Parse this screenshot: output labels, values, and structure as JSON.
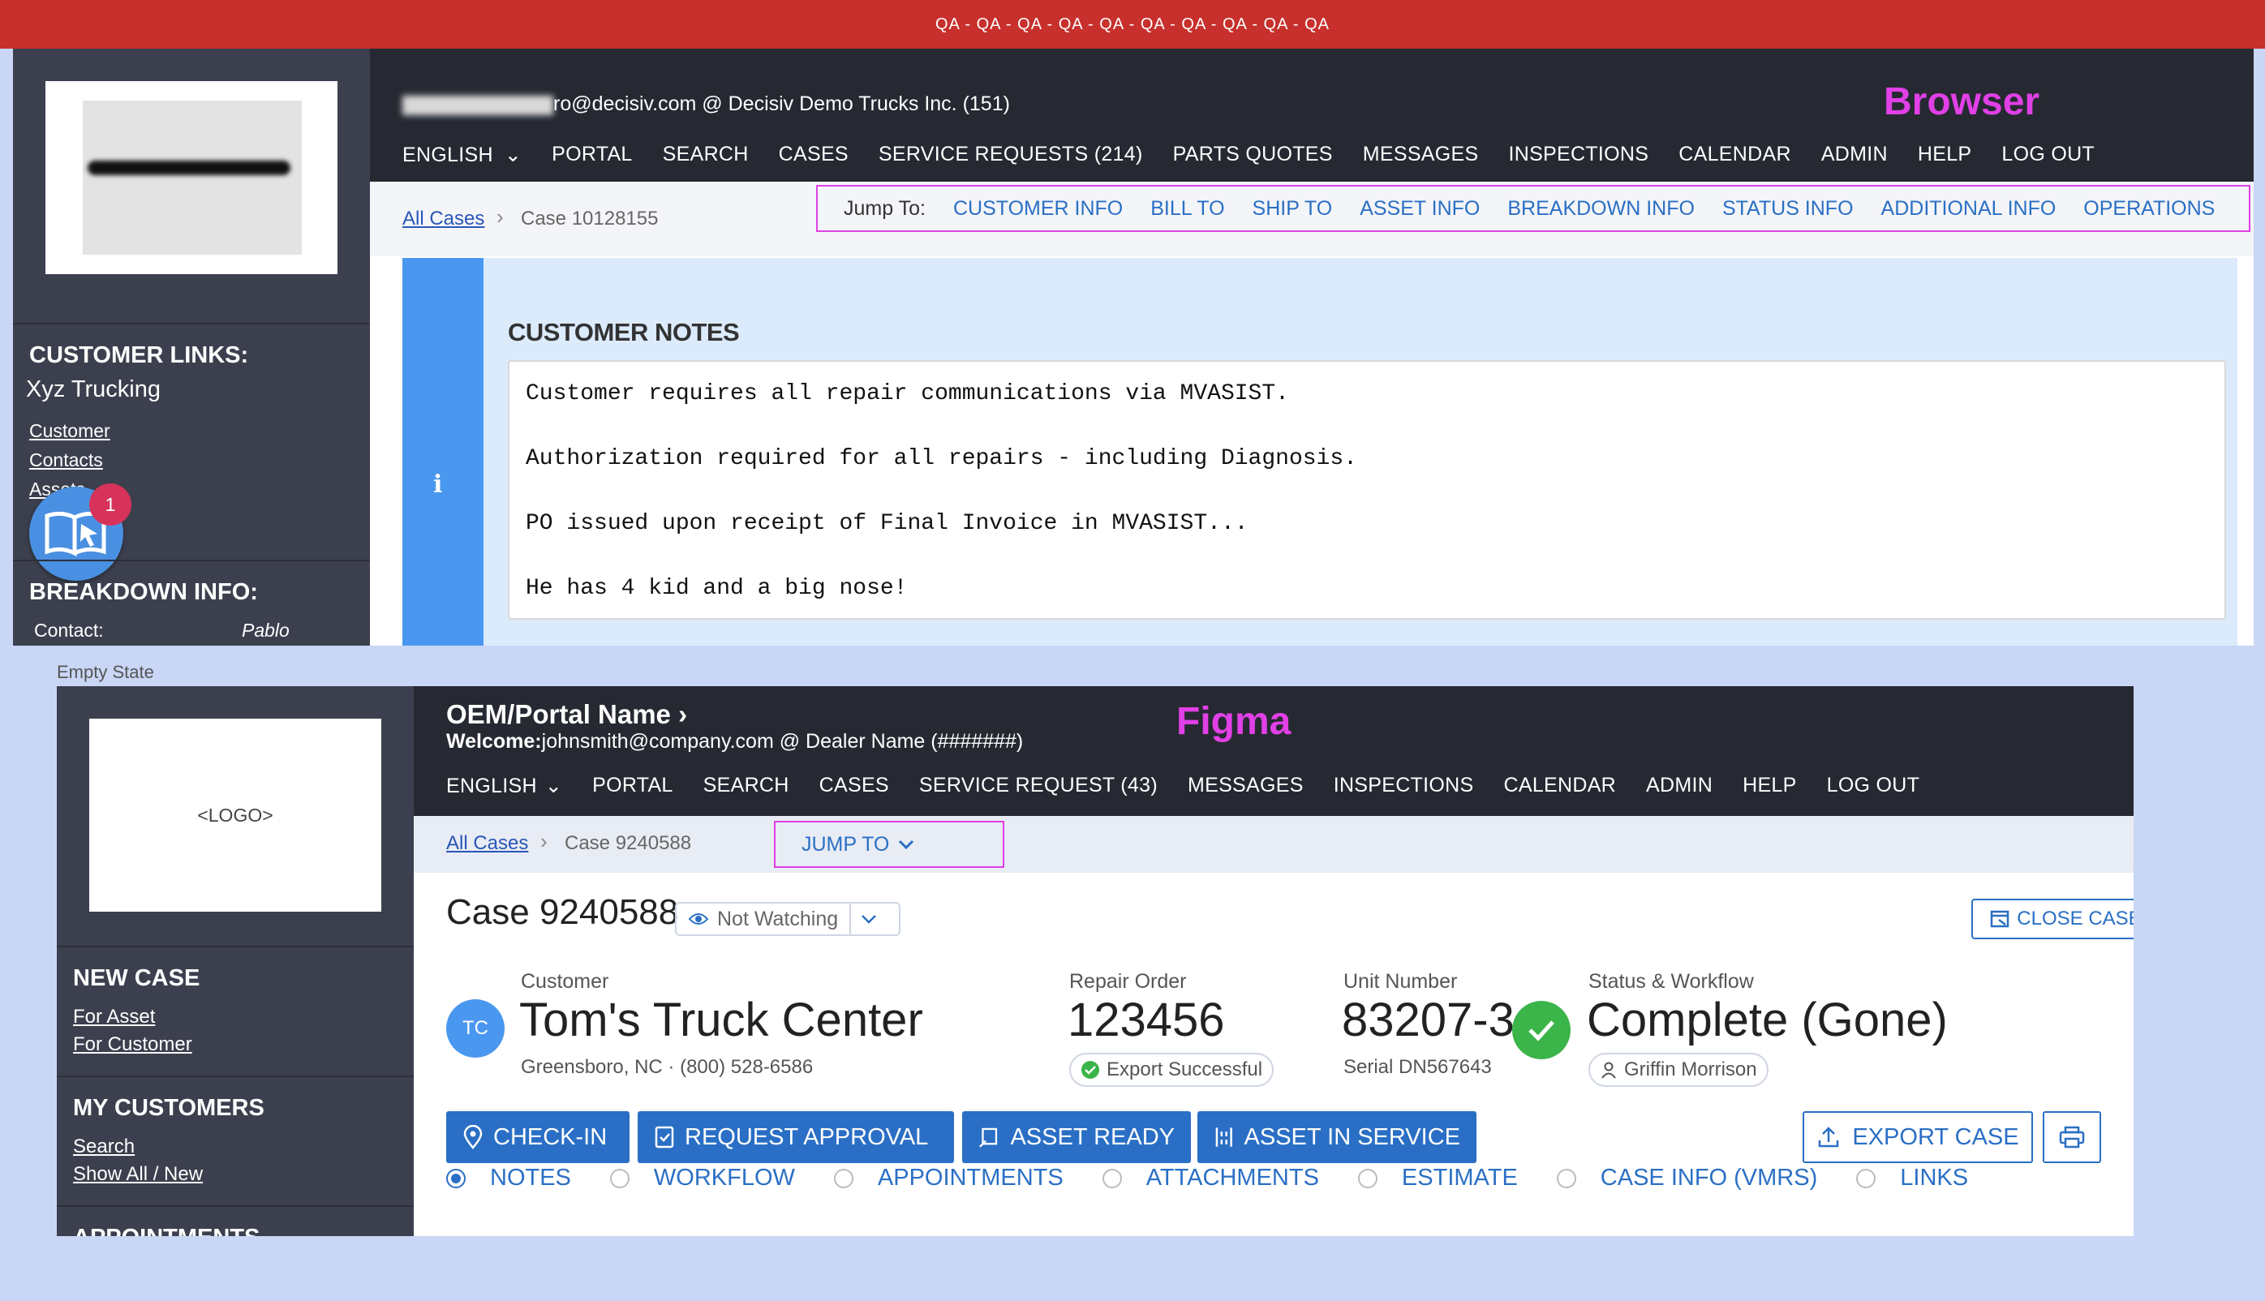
{
  "qa_banner": "QA - QA - QA - QA - QA - QA - QA - QA - QA - QA",
  "browser": {
    "label": "Browser",
    "user_email": "ro@decisiv.com @ Decisiv Demo Trucks Inc. (151)",
    "nav": [
      "ENGLISH",
      "PORTAL",
      "SEARCH",
      "CASES",
      "SERVICE REQUESTS (214)",
      "PARTS QUOTES",
      "MESSAGES",
      "INSPECTIONS",
      "CALENDAR",
      "ADMIN",
      "HELP",
      "LOG OUT"
    ],
    "breadcrumb": {
      "all_cases": "All Cases",
      "case": "Case 10128155"
    },
    "jump_to": {
      "label": "Jump To:",
      "items": [
        "CUSTOMER INFO",
        "BILL TO",
        "SHIP TO",
        "ASSET INFO",
        "BREAKDOWN INFO",
        "STATUS INFO",
        "ADDITIONAL INFO",
        "OPERATIONS"
      ]
    },
    "sidebar": {
      "customer_links_heading": "CUSTOMER LINKS:",
      "customer_name": "Xyz Trucking",
      "links": [
        "Customer",
        "Contacts",
        "Assets"
      ],
      "notification_count": "1",
      "breakdown_heading": "BREAKDOWN INFO:",
      "contact_label": "Contact:",
      "contact_value": "Pablo"
    },
    "customer_notes": {
      "heading": "CUSTOMER NOTES",
      "lines": [
        "Customer requires all repair communications via MVASIST.",
        "Authorization required for all repairs - including Diagnosis.",
        "PO issued upon receipt of Final Invoice in MVASIST...",
        "He has 4 kid and a big nose!"
      ]
    }
  },
  "empty_state_label": "Empty State",
  "figma": {
    "label": "Figma",
    "portal_name": "OEM/Portal Name",
    "welcome_label": "Welcome:",
    "welcome_text": "johnsmith@company.com @ Dealer Name (#######)",
    "nav": [
      "ENGLISH",
      "PORTAL",
      "SEARCH",
      "CASES",
      "SERVICE REQUEST (43)",
      "MESSAGES",
      "INSPECTIONS",
      "CALENDAR",
      "ADMIN",
      "HELP",
      "LOG OUT"
    ],
    "breadcrumb": {
      "all_cases": "All Cases",
      "case": "Case 9240588"
    },
    "jump_to": "JUMP TO",
    "sidebar": {
      "logo_placeholder": "<LOGO>",
      "new_case_heading": "NEW CASE",
      "new_case_links": [
        "For Asset",
        "For Customer"
      ],
      "my_customers_heading": "MY CUSTOMERS",
      "my_customers_links": [
        "Search",
        "Show All / New"
      ],
      "appointments_heading": "APPOINTMENTS"
    },
    "case": {
      "title": "Case 9240588",
      "watch_status": "Not Watching",
      "close_button": "CLOSE CASE",
      "customer_label": "Customer",
      "customer_initials": "TC",
      "customer_name": "Tom's Truck Center",
      "customer_location": "Greensboro, NC",
      "customer_phone": "(800) 528-6586",
      "repair_order_label": "Repair Order",
      "repair_order": "123456",
      "export_status": "Export Successful",
      "unit_number_label": "Unit Number",
      "unit_number": "83207-3",
      "serial": "Serial DN567643",
      "status_label": "Status & Workflow",
      "status": "Complete (Gone)",
      "assignee": "Griffin Morrison"
    },
    "actions": [
      "CHECK-IN",
      "REQUEST APPROVAL",
      "ASSET READY",
      "ASSET IN SERVICE"
    ],
    "export_button": "EXPORT CASE",
    "tabs": [
      "NOTES",
      "WORKFLOW",
      "APPOINTMENTS",
      "ATTACHMENTS",
      "ESTIMATE",
      "CASE INFO (VMRS)",
      "LINKS"
    ],
    "active_tab": "NOTES"
  },
  "colors": {
    "qa_red": "#c7302c",
    "dark_header": "#262932",
    "sidebar": "#3c404e",
    "accent_blue": "#2a6fc5",
    "highlight_magenta": "#e040e6",
    "success_green": "#3bb44a"
  }
}
